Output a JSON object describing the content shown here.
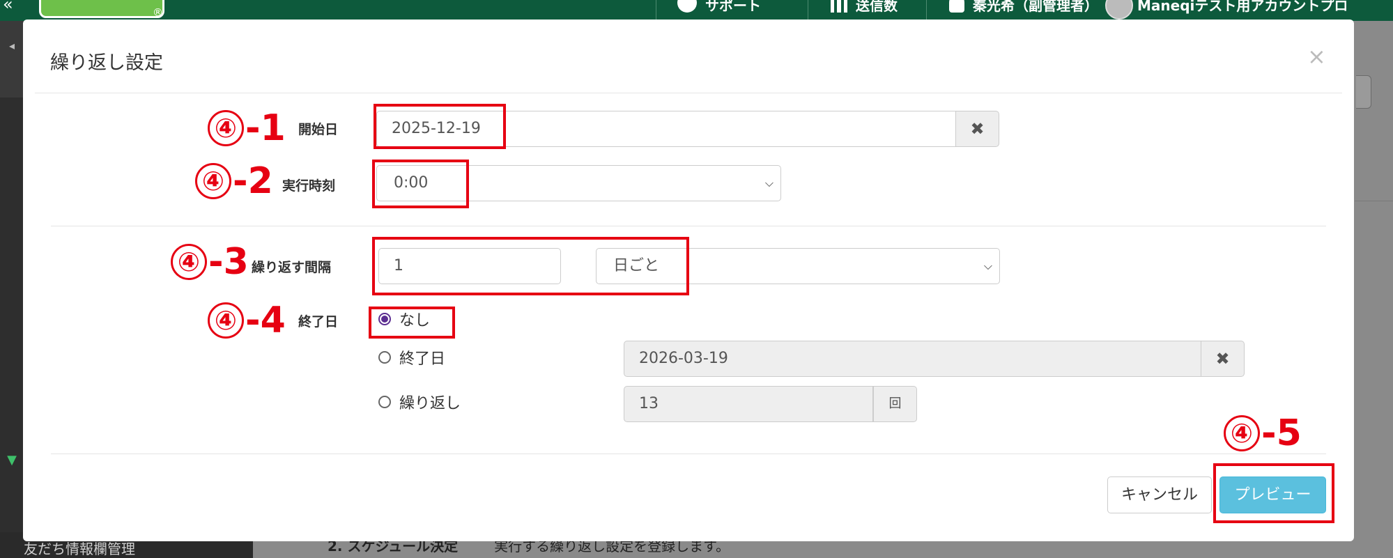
{
  "header": {
    "support_label": "サポート",
    "sent_label": "送信数",
    "user_label": "秦光希（副管理者）",
    "account_label": "Maneqiテスト用アカウントプロ"
  },
  "sidebar": {
    "bottom_item": "友だち情報欄管理"
  },
  "background": {
    "step_title": "2. スケジュール決定",
    "step_desc": "実行する繰り返し設定を登録します。"
  },
  "modal": {
    "title": "繰り返し設定",
    "close_glyph": "×",
    "fields": {
      "start_date": {
        "label": "開始日",
        "value": "2025-12-19",
        "clear_glyph": "✖"
      },
      "exec_time": {
        "label": "実行時刻",
        "value": "0:00"
      },
      "interval": {
        "label": "繰り返す間隔",
        "value": "1",
        "unit": "日ごと"
      },
      "end_date": {
        "label": "終了日",
        "options": [
          {
            "label": "なし",
            "checked": true
          },
          {
            "label": "終了日",
            "checked": false,
            "value": "2026-03-19",
            "clear_glyph": "✖"
          },
          {
            "label": "繰り返し",
            "checked": false,
            "value": "13",
            "unit": "回"
          }
        ]
      }
    },
    "buttons": {
      "cancel": "キャンセル",
      "preview": "プレビュー"
    }
  },
  "annotations": {
    "circle_digit": "④",
    "a1": "-1",
    "a2": "-2",
    "a3": "-3",
    "a4": "-4",
    "a5": "-5",
    "color": "#e60012"
  },
  "colors": {
    "header_bg": "#0d5a3c",
    "preview_button": "#5bc0de",
    "radio_checked": "#5b2d91"
  }
}
